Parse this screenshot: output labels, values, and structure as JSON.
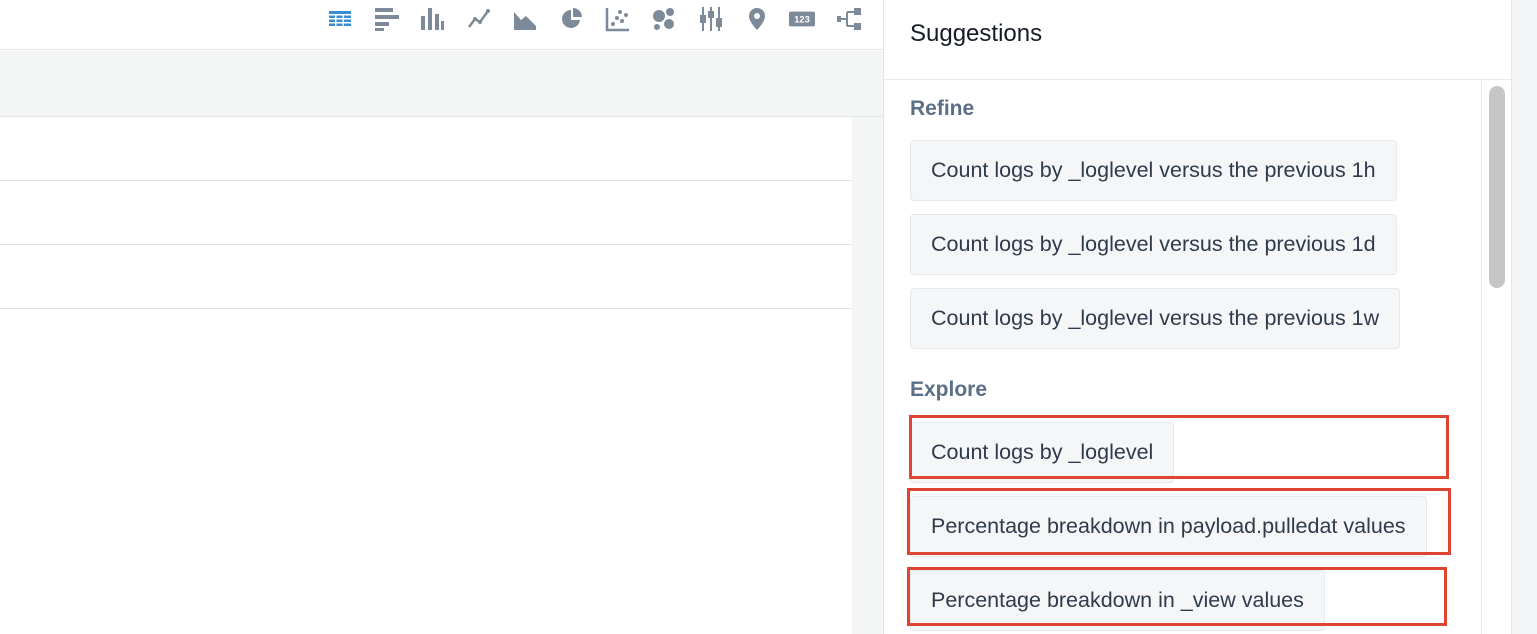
{
  "toolbar": {
    "icons": [
      {
        "name": "table-icon",
        "active": true
      },
      {
        "name": "horizontal-bar-chart-icon",
        "active": false
      },
      {
        "name": "column-chart-icon",
        "active": false
      },
      {
        "name": "line-chart-icon",
        "active": false
      },
      {
        "name": "area-chart-icon",
        "active": false
      },
      {
        "name": "pie-chart-icon",
        "active": false
      },
      {
        "name": "scatter-chart-icon",
        "active": false
      },
      {
        "name": "bubble-chart-icon",
        "active": false
      },
      {
        "name": "box-plot-icon",
        "active": false
      },
      {
        "name": "map-pin-icon",
        "active": false
      },
      {
        "name": "single-value-icon",
        "active": false
      },
      {
        "name": "sankey-icon",
        "active": false
      }
    ],
    "single_value_label": "123"
  },
  "colors": {
    "active_icon": "#3a8cd3",
    "inactive_icon": "#7d8a99",
    "highlight": "#dd4532",
    "chip_background": "#f4f6f7"
  },
  "suggestions": {
    "title": "Suggestions",
    "refine": {
      "label": "Refine",
      "items": [
        "Count logs by _loglevel versus the previous 1h",
        "Count logs by _loglevel versus the previous 1d",
        "Count logs by _loglevel versus the previous 1w"
      ]
    },
    "explore": {
      "label": "Explore",
      "items": [
        "Count logs by _loglevel",
        "Percentage breakdown in payload.pulledat values",
        "Percentage breakdown in _view values"
      ]
    }
  }
}
